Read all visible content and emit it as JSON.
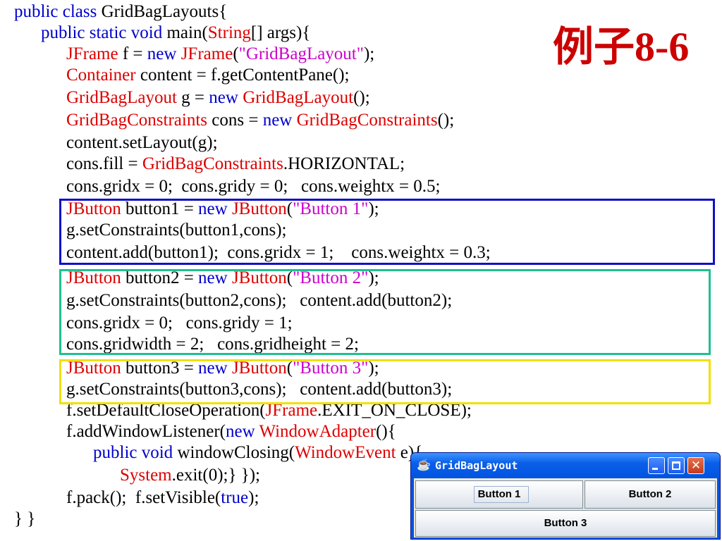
{
  "slide": {
    "title": "例子8-6",
    "title_color": "#cc0000",
    "code_colors": {
      "keyword": "#0000cc",
      "class": "#dd0000",
      "string": "#cc00cc",
      "plain": "#000000"
    },
    "highlight_colors": {
      "blue": "#1010c8",
      "teal": "#20c090",
      "yellow": "#f0e000"
    },
    "code_lines": [
      {
        "indent": 20,
        "segments": [
          {
            "t": "public class ",
            "c": "kw"
          },
          {
            "t": "GridBagLayouts{",
            "c": ""
          }
        ]
      },
      {
        "indent": 58,
        "segments": [
          {
            "t": "public static void ",
            "c": "kw"
          },
          {
            "t": "main(",
            "c": ""
          },
          {
            "t": "String",
            "c": "cls"
          },
          {
            "t": "[] args){",
            "c": ""
          }
        ]
      },
      {
        "indent": 94,
        "segments": [
          {
            "t": "JFrame",
            "c": "cls"
          },
          {
            "t": " f = ",
            "c": ""
          },
          {
            "t": "new ",
            "c": "kw"
          },
          {
            "t": "JFrame",
            "c": "cls"
          },
          {
            "t": "(",
            "c": ""
          },
          {
            "t": "\"GridBagLayout\"",
            "c": "str"
          },
          {
            "t": ");",
            "c": ""
          }
        ]
      },
      {
        "indent": 94,
        "segments": [
          {
            "t": "Container",
            "c": "cls"
          },
          {
            "t": " content = f.getContentPane();",
            "c": ""
          }
        ]
      },
      {
        "indent": 94,
        "segments": [
          {
            "t": "GridBagLayout",
            "c": "cls"
          },
          {
            "t": " g = ",
            "c": ""
          },
          {
            "t": "new ",
            "c": "kw"
          },
          {
            "t": "GridBagLayout",
            "c": "cls"
          },
          {
            "t": "();",
            "c": ""
          }
        ]
      },
      {
        "indent": 94,
        "segments": [
          {
            "t": "GridBagConstraints",
            "c": "cls"
          },
          {
            "t": " cons = ",
            "c": ""
          },
          {
            "t": "new ",
            "c": "kw"
          },
          {
            "t": "GridBagConstraints",
            "c": "cls"
          },
          {
            "t": "();",
            "c": ""
          }
        ]
      },
      {
        "indent": 94,
        "segments": [
          {
            "t": "content.setLayout(g);",
            "c": ""
          }
        ]
      },
      {
        "indent": 94,
        "segments": [
          {
            "t": "cons.fill = ",
            "c": ""
          },
          {
            "t": "GridBagConstraints",
            "c": "cls"
          },
          {
            "t": ".HORIZONTAL;",
            "c": ""
          }
        ]
      },
      {
        "indent": 94,
        "segments": [
          {
            "t": "cons.gridx = 0;  cons.gridy = 0;   cons.weightx = 0.5;",
            "c": ""
          }
        ]
      },
      {
        "indent": 94,
        "segments": [
          {
            "t": "JButton",
            "c": "cls"
          },
          {
            "t": " button1 = ",
            "c": ""
          },
          {
            "t": "new ",
            "c": "kw"
          },
          {
            "t": "JButton",
            "c": "cls"
          },
          {
            "t": "(",
            "c": ""
          },
          {
            "t": "\"Button 1\"",
            "c": "str"
          },
          {
            "t": ");",
            "c": ""
          }
        ]
      },
      {
        "indent": 94,
        "segments": [
          {
            "t": "g.setConstraints(button1,cons);",
            "c": ""
          }
        ]
      },
      {
        "indent": 94,
        "segments": [
          {
            "t": "content.add(button1);  cons.gridx = 1;    cons.weightx = 0.3;",
            "c": ""
          }
        ]
      },
      {
        "indent": 94,
        "segments": [
          {
            "t": "JButton",
            "c": "cls"
          },
          {
            "t": " button2 = ",
            "c": ""
          },
          {
            "t": "new ",
            "c": "kw"
          },
          {
            "t": "JButton",
            "c": "cls"
          },
          {
            "t": "(",
            "c": ""
          },
          {
            "t": "\"Button 2\"",
            "c": "str"
          },
          {
            "t": ");",
            "c": ""
          }
        ]
      },
      {
        "indent": 94,
        "segments": [
          {
            "t": "g.setConstraints(button2,cons);   content.add(button2);",
            "c": ""
          }
        ]
      },
      {
        "indent": 94,
        "segments": [
          {
            "t": "cons.gridx = 0;   cons.gridy = 1;",
            "c": ""
          }
        ]
      },
      {
        "indent": 94,
        "segments": [
          {
            "t": "cons.gridwidth = 2;   cons.gridheight = 2;",
            "c": ""
          }
        ]
      },
      {
        "indent": 94,
        "segments": [
          {
            "t": "JButton",
            "c": "cls"
          },
          {
            "t": " button3 = ",
            "c": ""
          },
          {
            "t": "new ",
            "c": "kw"
          },
          {
            "t": "JButton",
            "c": "cls"
          },
          {
            "t": "(",
            "c": ""
          },
          {
            "t": "\"Button 3\"",
            "c": "str"
          },
          {
            "t": ");",
            "c": ""
          }
        ]
      },
      {
        "indent": 94,
        "segments": [
          {
            "t": "g.setConstraints(button3,cons);   content.add(button3);",
            "c": ""
          }
        ]
      },
      {
        "indent": 94,
        "segments": [
          {
            "t": "f.setDefaultCloseOperation(",
            "c": ""
          },
          {
            "t": "JFrame",
            "c": "cls"
          },
          {
            "t": ".EXIT_ON_CLOSE);",
            "c": ""
          }
        ]
      },
      {
        "indent": 94,
        "segments": [
          {
            "t": "f.addWindowListener(",
            "c": ""
          },
          {
            "t": "new ",
            "c": "kw"
          },
          {
            "t": "WindowAdapter",
            "c": "cls"
          },
          {
            "t": "(){",
            "c": ""
          }
        ]
      },
      {
        "indent": 132,
        "segments": [
          {
            "t": "public void ",
            "c": "kw"
          },
          {
            "t": "windowClosing(",
            "c": ""
          },
          {
            "t": "WindowEvent",
            "c": "cls"
          },
          {
            "t": " e){",
            "c": ""
          }
        ]
      },
      {
        "indent": 170,
        "segments": [
          {
            "t": "System",
            "c": "cls"
          },
          {
            "t": ".exit(0);} });",
            "c": ""
          }
        ]
      },
      {
        "indent": 94,
        "segments": [
          {
            "t": "f.pack();  f.setVisible(",
            "c": ""
          },
          {
            "t": "true",
            "c": "kw"
          },
          {
            "t": ");",
            "c": ""
          }
        ]
      },
      {
        "indent": 20,
        "segments": [
          {
            "t": "} }",
            "c": ""
          }
        ]
      }
    ]
  },
  "window": {
    "title": "GridBagLayout",
    "app_icon": "java-cup-icon",
    "controls": {
      "minimize": "minimize-icon",
      "maximize": "maximize-icon",
      "close": "close-icon"
    },
    "close_glyph": "✕",
    "buttons": {
      "button1": "Button 1",
      "button2": "Button 2",
      "button3": "Button 3"
    }
  }
}
